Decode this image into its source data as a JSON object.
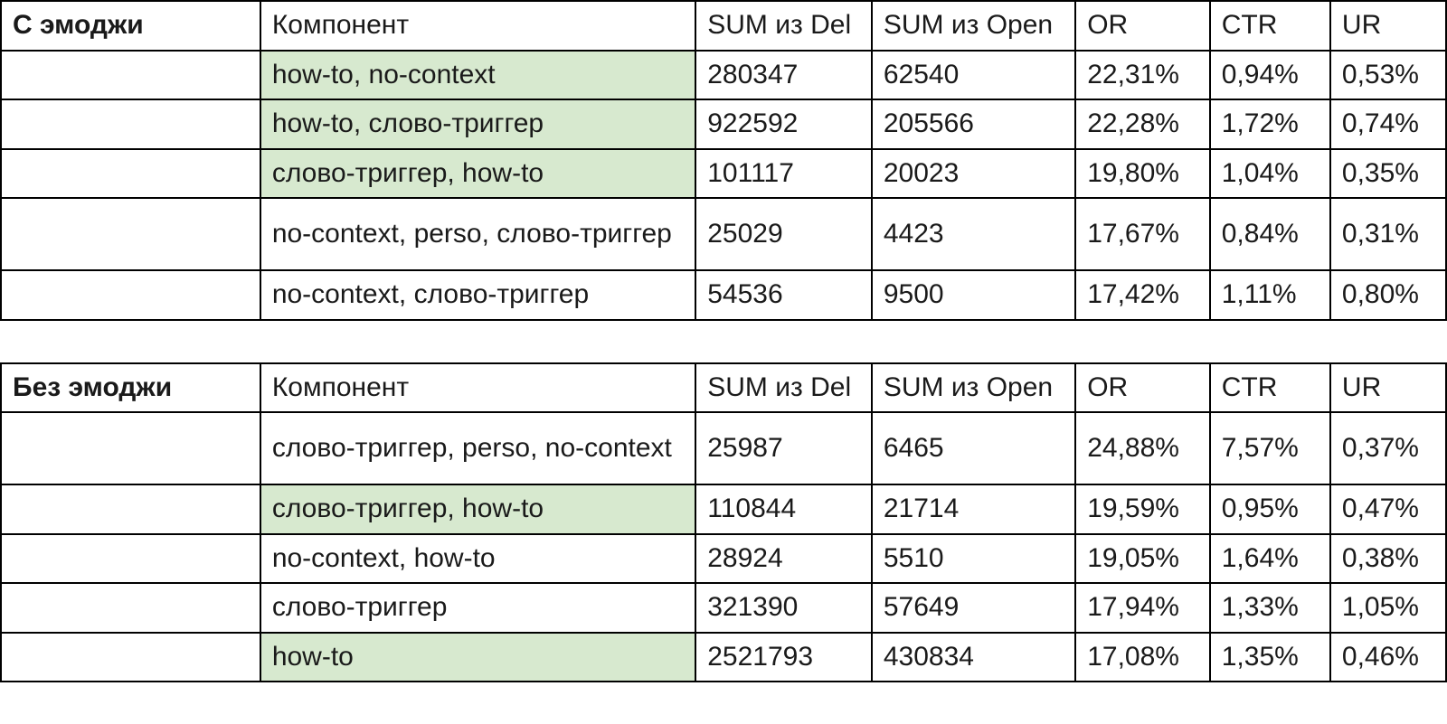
{
  "columns": {
    "component": "Компонент",
    "sum_del": "SUM из Del",
    "sum_open": "SUM из Open",
    "or": "OR",
    "ctr": "CTR",
    "ur": "UR"
  },
  "groups": [
    {
      "title": "С эмоджи",
      "rows": [
        {
          "component": "how-to, no-context",
          "sum_del": "280347",
          "sum_open": "62540",
          "or": "22,31%",
          "ctr": "0,94%",
          "ur": "0,53%",
          "highlight": true,
          "tall": false
        },
        {
          "component": "how-to, слово-триггер",
          "sum_del": "922592",
          "sum_open": "205566",
          "or": "22,28%",
          "ctr": "1,72%",
          "ur": "0,74%",
          "highlight": true,
          "tall": false
        },
        {
          "component": "слово-триггер, how-to",
          "sum_del": "101117",
          "sum_open": "20023",
          "or": "19,80%",
          "ctr": "1,04%",
          "ur": "0,35%",
          "highlight": true,
          "tall": false
        },
        {
          "component": "no-context, perso, слово-триггер",
          "sum_del": "25029",
          "sum_open": "4423",
          "or": "17,67%",
          "ctr": "0,84%",
          "ur": "0,31%",
          "highlight": false,
          "tall": true
        },
        {
          "component": "no-context, слово-триггер",
          "sum_del": "54536",
          "sum_open": "9500",
          "or": "17,42%",
          "ctr": "1,11%",
          "ur": "0,80%",
          "highlight": false,
          "tall": false
        }
      ]
    },
    {
      "title": "Без эмоджи",
      "rows": [
        {
          "component": "слово-триггер, perso, no-context",
          "sum_del": "25987",
          "sum_open": "6465",
          "or": "24,88%",
          "ctr": "7,57%",
          "ur": "0,37%",
          "highlight": false,
          "tall": true
        },
        {
          "component": "слово-триггер, how-to",
          "sum_del": "110844",
          "sum_open": "21714",
          "or": "19,59%",
          "ctr": "0,95%",
          "ur": "0,47%",
          "highlight": true,
          "tall": false
        },
        {
          "component": "no-context, how-to",
          "sum_del": "28924",
          "sum_open": "5510",
          "or": "19,05%",
          "ctr": "1,64%",
          "ur": "0,38%",
          "highlight": false,
          "tall": false
        },
        {
          "component": "слово-триггер",
          "sum_del": "321390",
          "sum_open": "57649",
          "or": "17,94%",
          "ctr": "1,33%",
          "ur": "1,05%",
          "highlight": false,
          "tall": false
        },
        {
          "component": "how-to",
          "sum_del": "2521793",
          "sum_open": "430834",
          "or": "17,08%",
          "ctr": "1,35%",
          "ur": "0,46%",
          "highlight": true,
          "tall": false
        }
      ]
    }
  ],
  "chart_data": [
    {
      "type": "table",
      "title": "С эмоджи",
      "columns": [
        "Компонент",
        "SUM из Del",
        "SUM из Open",
        "OR",
        "CTR",
        "UR"
      ],
      "rows": [
        [
          "how-to, no-context",
          280347,
          62540,
          "22,31%",
          "0,94%",
          "0,53%"
        ],
        [
          "how-to, слово-триггер",
          922592,
          205566,
          "22,28%",
          "1,72%",
          "0,74%"
        ],
        [
          "слово-триггер, how-to",
          101117,
          20023,
          "19,80%",
          "1,04%",
          "0,35%"
        ],
        [
          "no-context, perso, слово-триггер",
          25029,
          4423,
          "17,67%",
          "0,84%",
          "0,31%"
        ],
        [
          "no-context, слово-триггер",
          54536,
          9500,
          "17,42%",
          "1,11%",
          "0,80%"
        ]
      ]
    },
    {
      "type": "table",
      "title": "Без эмоджи",
      "columns": [
        "Компонент",
        "SUM из Del",
        "SUM из Open",
        "OR",
        "CTR",
        "UR"
      ],
      "rows": [
        [
          "слово-триггер, perso, no-context",
          25987,
          6465,
          "24,88%",
          "7,57%",
          "0,37%"
        ],
        [
          "слово-триггер, how-to",
          110844,
          21714,
          "19,59%",
          "0,95%",
          "0,47%"
        ],
        [
          "no-context, how-to",
          28924,
          5510,
          "19,05%",
          "1,64%",
          "0,38%"
        ],
        [
          "слово-триггер",
          321390,
          57649,
          "17,94%",
          "1,33%",
          "1,05%"
        ],
        [
          "how-to",
          2521793,
          430834,
          "17,08%",
          "1,35%",
          "0,46%"
        ]
      ]
    }
  ]
}
